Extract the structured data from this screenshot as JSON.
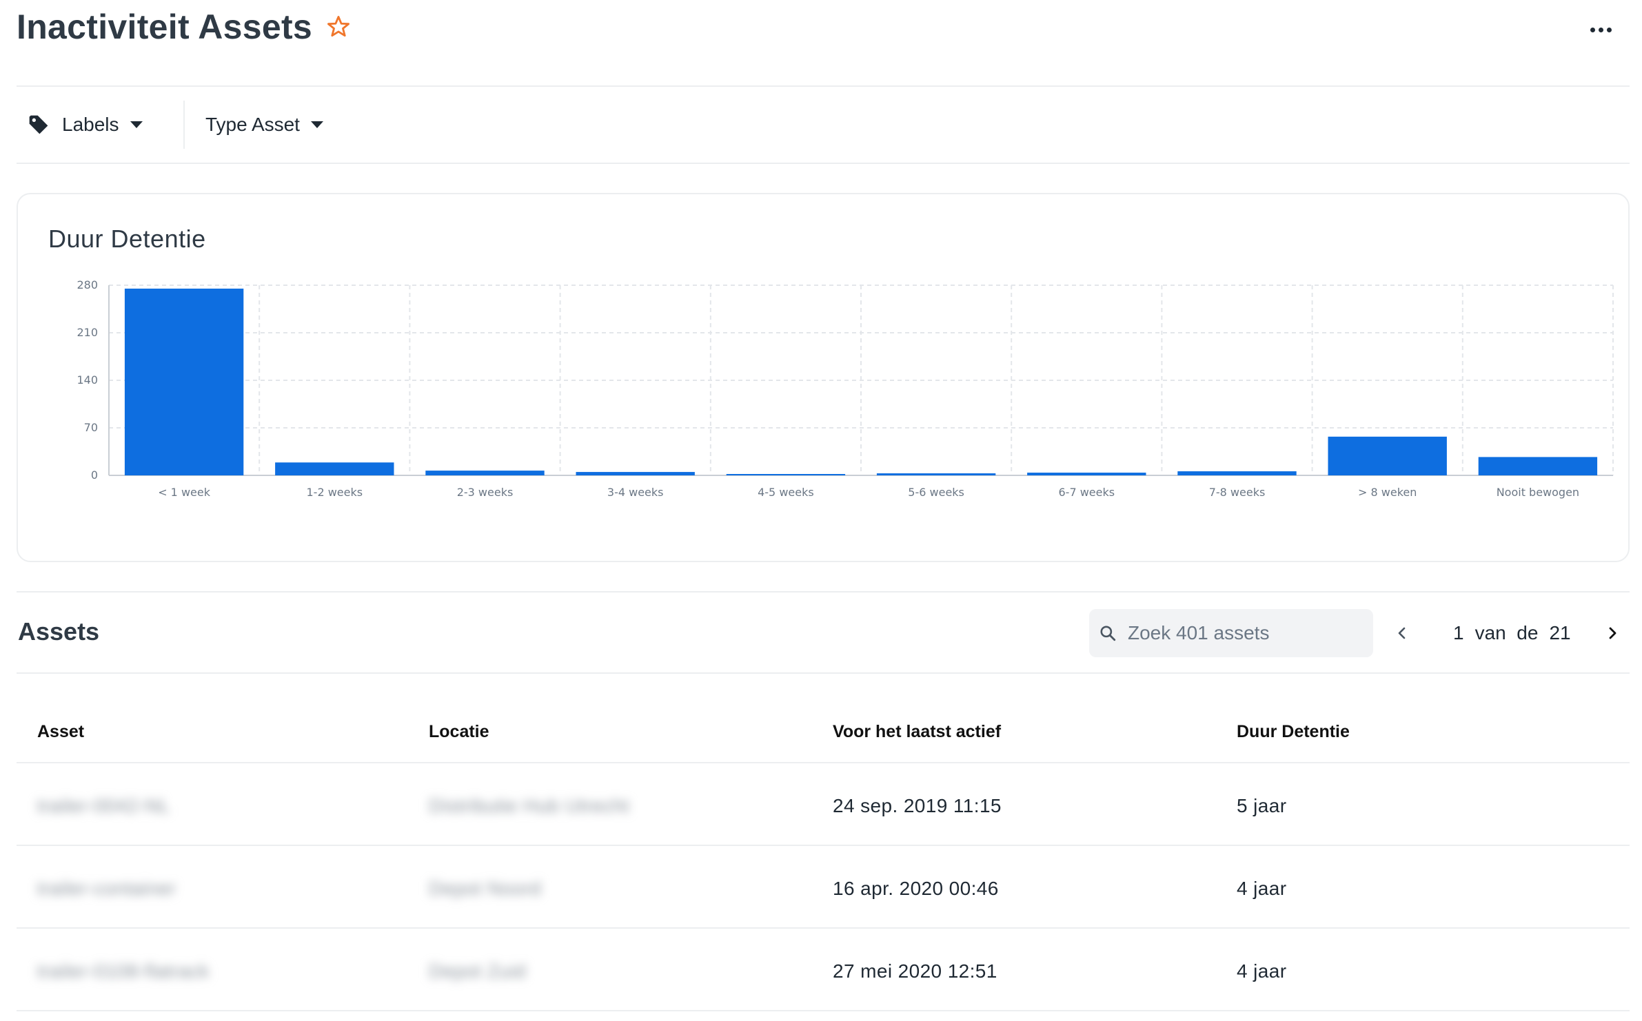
{
  "header": {
    "title": "Inactiviteit Assets",
    "favorite_icon": "star-outline-icon",
    "more_icon": "more-horizontal-icon",
    "accent_color": "#f0762b"
  },
  "filters": {
    "labels": "Labels",
    "type_asset": "Type Asset"
  },
  "chart_card": {
    "title": "Duur Detentie"
  },
  "chart_data": {
    "type": "bar",
    "title": "Duur Detentie",
    "categories": [
      "< 1 week",
      "1-2 weeks",
      "2-3 weeks",
      "3-4 weeks",
      "4-5 weeks",
      "5-6 weeks",
      "6-7 weeks",
      "7-8 weeks",
      "> 8 weken",
      "Nooit bewogen"
    ],
    "values": [
      275,
      19,
      7,
      5,
      1,
      3,
      4,
      6,
      57,
      27
    ],
    "ylim": [
      0,
      280
    ],
    "yticks": [
      0,
      70,
      140,
      210,
      280
    ],
    "grid": true,
    "bar_color": "#0e6ee0"
  },
  "assets": {
    "title": "Assets",
    "search_placeholder": "Zoek 401 assets",
    "pager": {
      "current": "1",
      "of": "van  de",
      "total": "21"
    }
  },
  "table": {
    "columns": [
      "Asset",
      "Locatie",
      "Voor het laatst actief",
      "Duur Detentie"
    ],
    "rows": [
      {
        "asset": "trailer-0042-NL",
        "locatie": "Distributie Hub Utrecht",
        "last_active": "24 sep. 2019 11:15",
        "duration": "5 jaar"
      },
      {
        "asset": "trailer-container",
        "locatie": "Depot Noord",
        "last_active": "16 apr. 2020 00:46",
        "duration": "4 jaar"
      },
      {
        "asset": "trailer-0108-flatrack",
        "locatie": "Depot Zuid",
        "last_active": "27 mei 2020 12:51",
        "duration": "4 jaar"
      }
    ]
  }
}
